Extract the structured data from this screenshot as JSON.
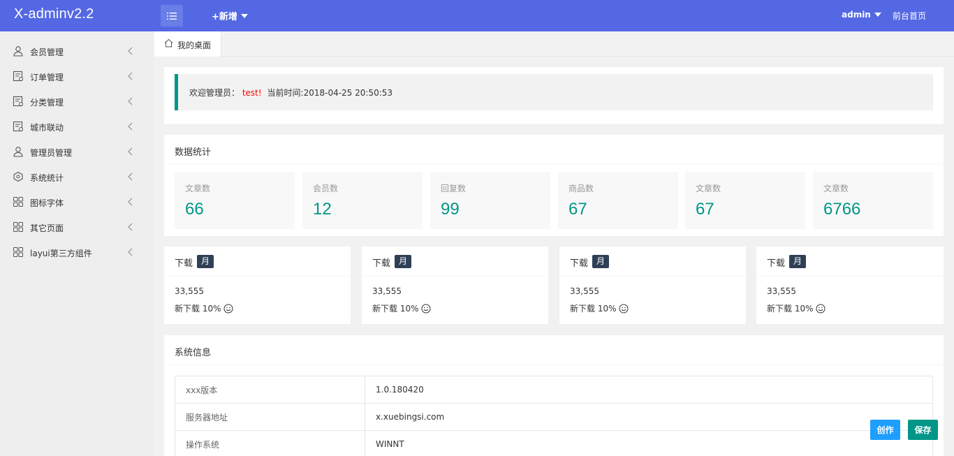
{
  "header": {
    "logo": "X-adminv2.2",
    "add_new": "+新增",
    "user": "admin",
    "front_home": "前台首页"
  },
  "sidebar": {
    "items": [
      {
        "label": "会员管理",
        "icon": "user-icon"
      },
      {
        "label": "订单管理",
        "icon": "order-icon"
      },
      {
        "label": "分类管理",
        "icon": "category-icon"
      },
      {
        "label": "城市联动",
        "icon": "city-icon"
      },
      {
        "label": "管理员管理",
        "icon": "admin-user-icon"
      },
      {
        "label": "系统统计",
        "icon": "stats-icon"
      },
      {
        "label": "图标字体",
        "icon": "grid-icon"
      },
      {
        "label": "其它页面",
        "icon": "grid-icon"
      },
      {
        "label": "layui第三方组件",
        "icon": "grid-icon"
      }
    ]
  },
  "tabs": [
    {
      "label": "我的桌面"
    }
  ],
  "welcome": {
    "prefix": "欢迎管理员：",
    "name": "test!",
    "time_text": "当前时间:2018-04-25 20:50:53"
  },
  "stats": {
    "title": "数据统计",
    "items": [
      {
        "label": "文章数",
        "value": "66"
      },
      {
        "label": "会员数",
        "value": "12"
      },
      {
        "label": "回复数",
        "value": "99"
      },
      {
        "label": "商品数",
        "value": "67"
      },
      {
        "label": "文章数",
        "value": "67"
      },
      {
        "label": "文章数",
        "value": "6766"
      }
    ]
  },
  "downloads": [
    {
      "title": "下载",
      "badge": "月",
      "value": "33,555",
      "sub": "新下载 10%"
    },
    {
      "title": "下载",
      "badge": "月",
      "value": "33,555",
      "sub": "新下载 10%"
    },
    {
      "title": "下载",
      "badge": "月",
      "value": "33,555",
      "sub": "新下载 10%"
    },
    {
      "title": "下载",
      "badge": "月",
      "value": "33,555",
      "sub": "新下载 10%"
    }
  ],
  "system": {
    "title": "系统信息",
    "rows": [
      {
        "key": "xxx版本",
        "value": "1.0.180420"
      },
      {
        "key": "服务器地址",
        "value": "x.xuebingsi.com"
      },
      {
        "key": "操作系统",
        "value": "WINNT"
      }
    ]
  },
  "buttons": {
    "create": "创作",
    "save": "保存"
  },
  "colors": {
    "header": "#5468e4",
    "accent": "#009688",
    "badge": "#2f4056",
    "create_button": "#1e9fff"
  }
}
